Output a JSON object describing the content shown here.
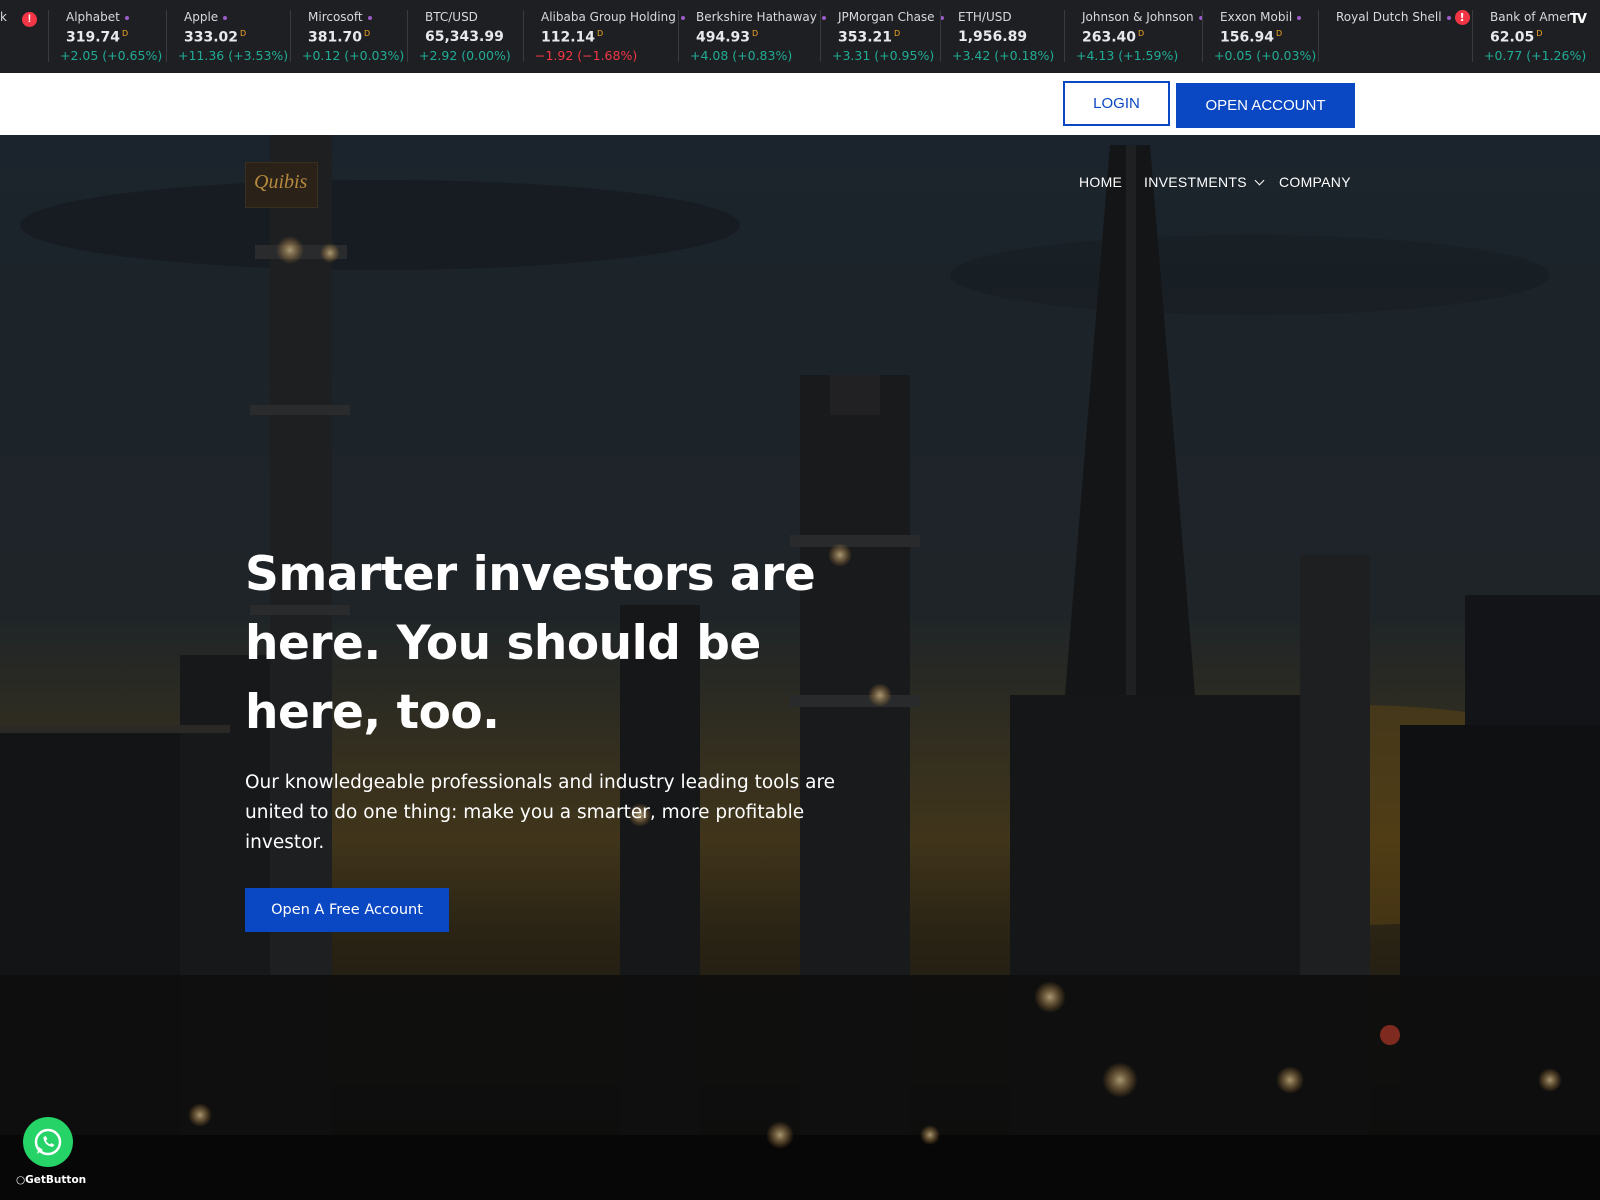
{
  "ticker": {
    "lead_fragment": "k",
    "items": [
      {
        "name": "Alphabet",
        "price": "319.74",
        "change": "+2.05 (+0.65%)",
        "dir": "up",
        "dot": true,
        "delayed": true
      },
      {
        "name": "Apple",
        "price": "333.02",
        "change": "+11.36 (+3.53%)",
        "dir": "up",
        "dot": true,
        "delayed": true
      },
      {
        "name": "Mircosoft",
        "price": "381.70",
        "change": "+0.12 (+0.03%)",
        "dir": "up",
        "dot": true,
        "delayed": true
      },
      {
        "name": "BTC/USD",
        "price": "65,343.99",
        "change": "+2.92 (0.00%)",
        "dir": "up",
        "dot": false,
        "delayed": false
      },
      {
        "name": "Alibaba Group Holding",
        "price": "112.14",
        "change": "−1.92 (−1.68%)",
        "dir": "down",
        "dot": true,
        "delayed": true
      },
      {
        "name": "Berkshire Hathaway",
        "price": "494.93",
        "change": "+4.08 (+0.83%)",
        "dir": "up",
        "dot": true,
        "delayed": true
      },
      {
        "name": "JPMorgan Chase",
        "price": "353.21",
        "change": "+3.31 (+0.95%)",
        "dir": "up",
        "dot": true,
        "delayed": true
      },
      {
        "name": "ETH/USD",
        "price": "1,956.89",
        "change": "+3.42 (+0.18%)",
        "dir": "up",
        "dot": false,
        "delayed": false
      },
      {
        "name": "Johnson & Johnson",
        "price": "263.40",
        "change": "+4.13 (+1.59%)",
        "dir": "up",
        "dot": true,
        "delayed": true
      },
      {
        "name": "Exxon Mobil",
        "price": "156.94",
        "change": "+0.05 (+0.03%)",
        "dir": "up",
        "dot": true,
        "delayed": true
      },
      {
        "name": "Royal Dutch Shell",
        "price": "",
        "change": "",
        "dir": "up",
        "dot": true,
        "delayed": false,
        "warning": true
      },
      {
        "name": "Bank of Americ",
        "price": "62.05",
        "change": "+0.77 (+1.26%)",
        "dir": "up",
        "dot": false,
        "delayed": true
      }
    ],
    "delayed_marker": "D",
    "warning_symbol": "!",
    "brand_mark": "TV"
  },
  "topbar": {
    "login_label": "LOGIN",
    "open_account_label": "OPEN ACCOUNT"
  },
  "brand": {
    "logo_text": "Quibis"
  },
  "nav": {
    "home": "HOME",
    "investments": "INVESTMENTS",
    "company": "COMPANY"
  },
  "hero": {
    "headline": "Smarter investors are here. You should be here, too.",
    "lead": "Our knowledgeable professionals and industry leading tools are united to do one thing: make you a smarter, more profitable investor.",
    "cta_label": "Open A Free Account"
  },
  "widget": {
    "getbutton_label": "GetButton"
  },
  "colors": {
    "accent": "#0a47c2",
    "ticker_bg": "#1e1f23",
    "up": "#22ab94",
    "down": "#f23645",
    "whatsapp": "#25d366"
  }
}
